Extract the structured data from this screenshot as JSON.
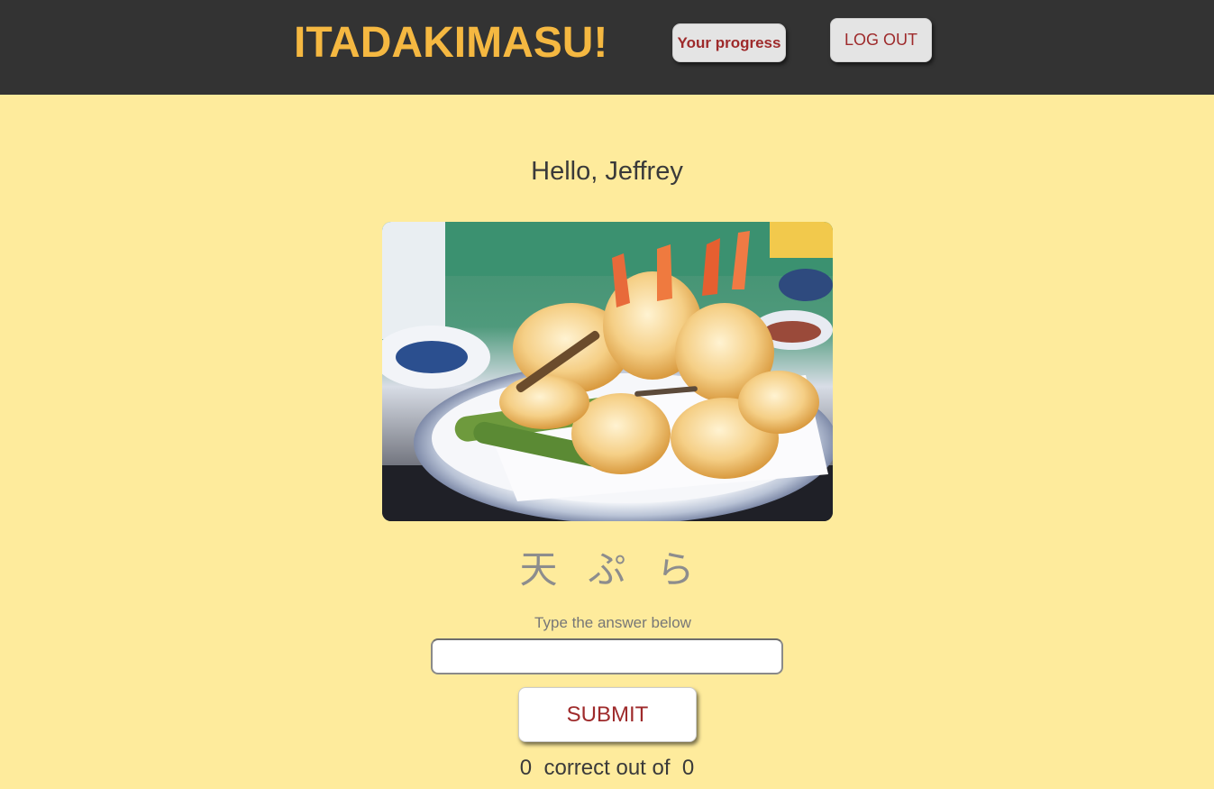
{
  "header": {
    "brand": "ITADAKIMASU!",
    "progress_label": "Your progress",
    "logout_label": "LOG OUT"
  },
  "main": {
    "greeting": "Hello, Jeffrey",
    "word_chars": [
      "天",
      "ぷ",
      "ら"
    ],
    "prompt": "Type the answer below",
    "answer_value": "",
    "submit_label": "SUBMIT",
    "score": {
      "correct": "0",
      "middle": "correct out of",
      "total": "0"
    }
  },
  "colors": {
    "header_bg": "#333333",
    "page_bg": "#feeb9c",
    "brand": "#f5b841",
    "button_text": "#9e2a2b"
  }
}
